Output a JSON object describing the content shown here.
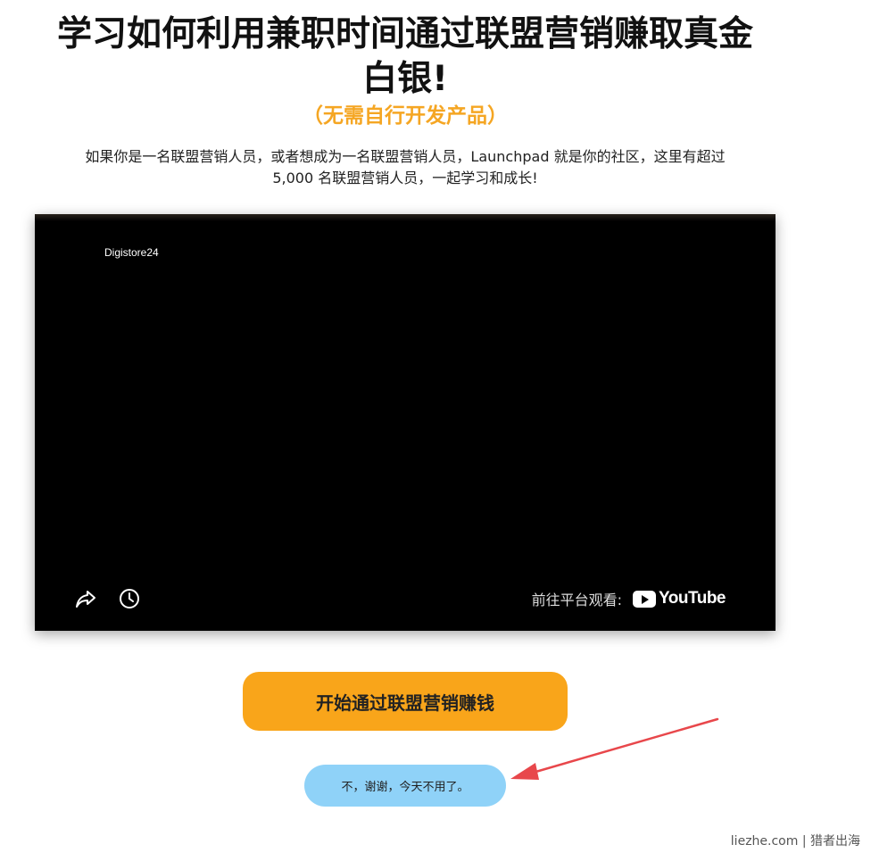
{
  "headline": {
    "line1": "学习如何利用兼职时间通过联盟营销赚取真金",
    "line2": "白银!"
  },
  "subheadline": "（无需自行开发产品）",
  "description": {
    "line1": "如果你是一名联盟营销人员，或者想成为一名联盟营销人员，Launchpad 就是你的社区，这里有超过",
    "line2": "5,000 名联盟营销人员，一起学习和成长!"
  },
  "video": {
    "channel_name": "Digistore24",
    "watch_on_label": "前往平台观看:",
    "platform_name": "YouTube",
    "icons": {
      "share": "share-icon",
      "watch_later": "clock-icon",
      "youtube": "youtube-logo-icon"
    }
  },
  "cta_button_label": "开始通过联盟营销赚钱",
  "decline_button_label": "不，谢谢，今天不用了。",
  "annotation": {
    "arrow_color": "#e8474b"
  },
  "watermark": "liezhe.com | 猎者出海",
  "colors": {
    "accent_orange": "#f9a51a",
    "subheadline_orange": "#f5a623",
    "decline_blue": "#8fd2f8",
    "video_bg": "#000000"
  }
}
